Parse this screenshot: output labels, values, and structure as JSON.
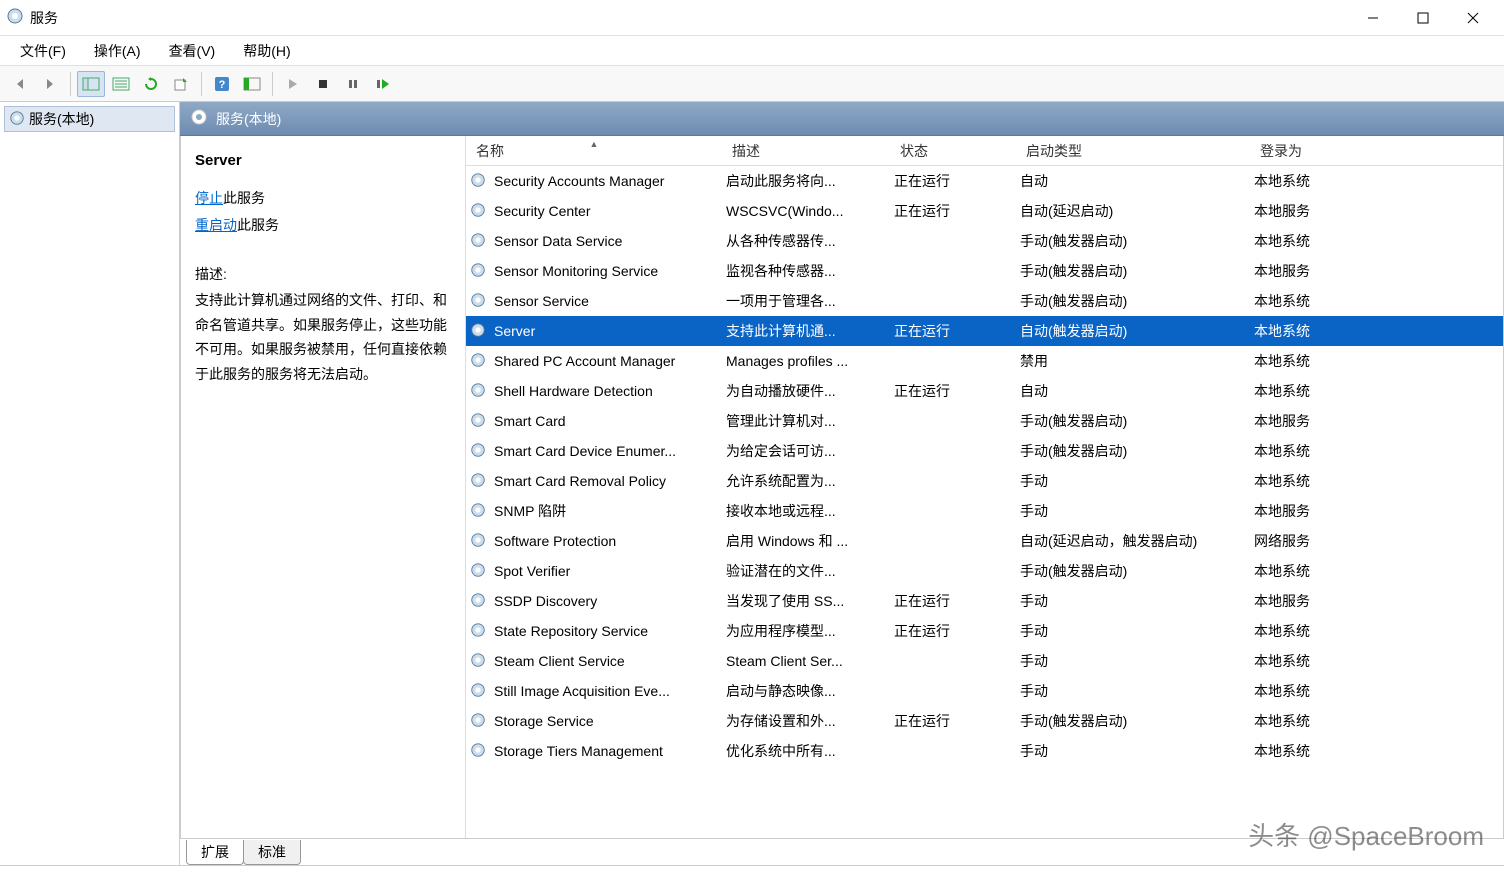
{
  "window": {
    "title": "服务"
  },
  "menu": {
    "file": "文件(F)",
    "action": "操作(A)",
    "view": "查看(V)",
    "help": "帮助(H)"
  },
  "tree": {
    "root": "服务(本地)"
  },
  "pane": {
    "title": "服务(本地)"
  },
  "details": {
    "service_name": "Server",
    "stop_link": "停止",
    "stop_suffix": "此服务",
    "restart_link": "重启动",
    "restart_suffix": "此服务",
    "desc_label": "描述:",
    "description": "支持此计算机通过网络的文件、打印、和命名管道共享。如果服务停止，这些功能不可用。如果服务被禁用，任何直接依赖于此服务的服务将无法启动。"
  },
  "columns": {
    "name": "名称",
    "desc": "描述",
    "status": "状态",
    "startup": "启动类型",
    "logon": "登录为"
  },
  "rows": [
    {
      "name": "Security Accounts Manager",
      "desc": "启动此服务将向...",
      "status": "正在运行",
      "startup": "自动",
      "logon": "本地系统",
      "selected": false
    },
    {
      "name": "Security Center",
      "desc": "WSCSVC(Windo...",
      "status": "正在运行",
      "startup": "自动(延迟启动)",
      "logon": "本地服务",
      "selected": false
    },
    {
      "name": "Sensor Data Service",
      "desc": "从各种传感器传...",
      "status": "",
      "startup": "手动(触发器启动)",
      "logon": "本地系统",
      "selected": false
    },
    {
      "name": "Sensor Monitoring Service",
      "desc": "监视各种传感器...",
      "status": "",
      "startup": "手动(触发器启动)",
      "logon": "本地服务",
      "selected": false
    },
    {
      "name": "Sensor Service",
      "desc": "一项用于管理各...",
      "status": "",
      "startup": "手动(触发器启动)",
      "logon": "本地系统",
      "selected": false
    },
    {
      "name": "Server",
      "desc": "支持此计算机通...",
      "status": "正在运行",
      "startup": "自动(触发器启动)",
      "logon": "本地系统",
      "selected": true
    },
    {
      "name": "Shared PC Account Manager",
      "desc": "Manages profiles ...",
      "status": "",
      "startup": "禁用",
      "logon": "本地系统",
      "selected": false
    },
    {
      "name": "Shell Hardware Detection",
      "desc": "为自动播放硬件...",
      "status": "正在运行",
      "startup": "自动",
      "logon": "本地系统",
      "selected": false
    },
    {
      "name": "Smart Card",
      "desc": "管理此计算机对...",
      "status": "",
      "startup": "手动(触发器启动)",
      "logon": "本地服务",
      "selected": false
    },
    {
      "name": "Smart Card Device Enumer...",
      "desc": "为给定会话可访...",
      "status": "",
      "startup": "手动(触发器启动)",
      "logon": "本地系统",
      "selected": false
    },
    {
      "name": "Smart Card Removal Policy",
      "desc": "允许系统配置为...",
      "status": "",
      "startup": "手动",
      "logon": "本地系统",
      "selected": false
    },
    {
      "name": "SNMP 陷阱",
      "desc": "接收本地或远程...",
      "status": "",
      "startup": "手动",
      "logon": "本地服务",
      "selected": false
    },
    {
      "name": "Software Protection",
      "desc": "启用 Windows 和 ...",
      "status": "",
      "startup": "自动(延迟启动，触发器启动)",
      "logon": "网络服务",
      "selected": false
    },
    {
      "name": "Spot Verifier",
      "desc": "验证潜在的文件...",
      "status": "",
      "startup": "手动(触发器启动)",
      "logon": "本地系统",
      "selected": false
    },
    {
      "name": "SSDP Discovery",
      "desc": "当发现了使用 SS...",
      "status": "正在运行",
      "startup": "手动",
      "logon": "本地服务",
      "selected": false
    },
    {
      "name": "State Repository Service",
      "desc": "为应用程序模型...",
      "status": "正在运行",
      "startup": "手动",
      "logon": "本地系统",
      "selected": false
    },
    {
      "name": "Steam Client Service",
      "desc": "Steam Client Ser...",
      "status": "",
      "startup": "手动",
      "logon": "本地系统",
      "selected": false
    },
    {
      "name": "Still Image Acquisition Eve...",
      "desc": "启动与静态映像...",
      "status": "",
      "startup": "手动",
      "logon": "本地系统",
      "selected": false
    },
    {
      "name": "Storage Service",
      "desc": "为存储设置和外...",
      "status": "正在运行",
      "startup": "手动(触发器启动)",
      "logon": "本地系统",
      "selected": false
    },
    {
      "name": "Storage Tiers Management",
      "desc": "优化系统中所有...",
      "status": "",
      "startup": "手动",
      "logon": "本地系统",
      "selected": false
    }
  ],
  "tabs": {
    "extended": "扩展",
    "standard": "标准"
  },
  "watermark": "头条 @SpaceBroom"
}
